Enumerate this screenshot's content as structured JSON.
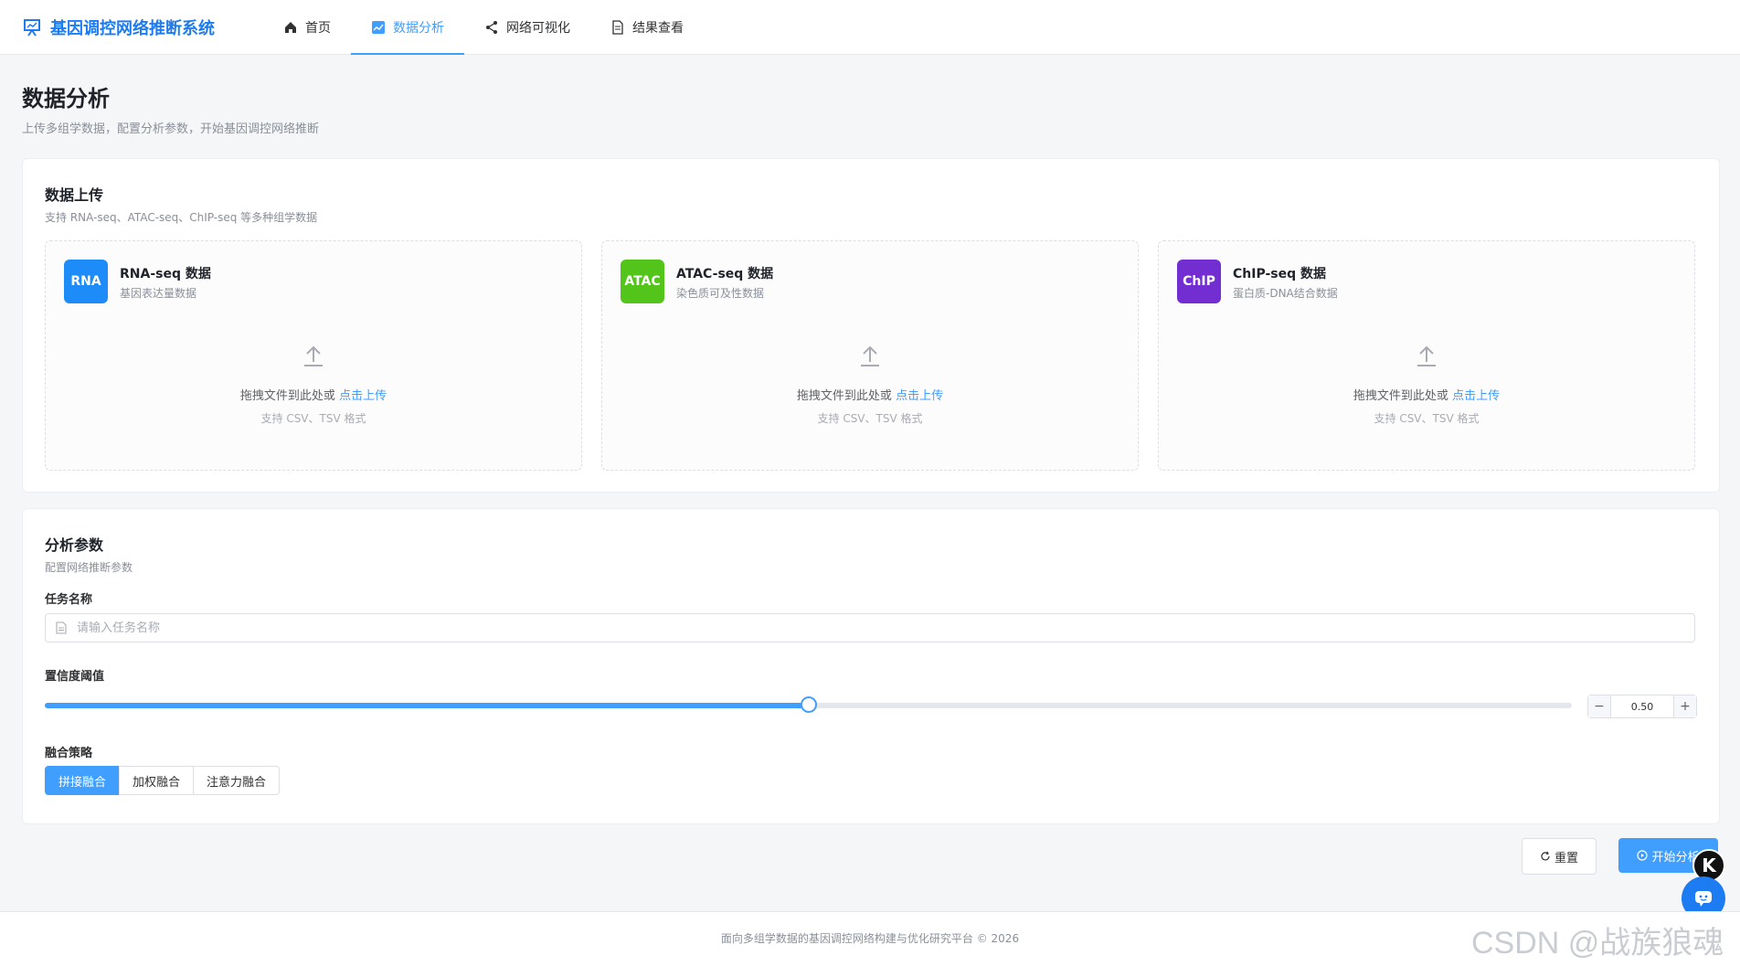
{
  "app": {
    "title": "基因调控网络推断系统"
  },
  "nav": {
    "items": [
      {
        "label": "首页",
        "icon": "home-icon"
      },
      {
        "label": "数据分析",
        "icon": "chart-icon",
        "active": true
      },
      {
        "label": "网络可视化",
        "icon": "share-icon"
      },
      {
        "label": "结果查看",
        "icon": "document-icon"
      }
    ]
  },
  "page": {
    "title": "数据分析",
    "subtitle": "上传多组学数据，配置分析参数，开始基因调控网络推断"
  },
  "upload": {
    "title": "数据上传",
    "desc": "支持 RNA-seq、ATAC-seq、ChIP-seq 等多种组学数据",
    "boxes": [
      {
        "badge": "RNA",
        "badge_color": "#1d8cf8",
        "title": "RNA-seq 数据",
        "sub": "基因表达量数据"
      },
      {
        "badge": "ATAC",
        "badge_color": "#52c41a",
        "title": "ATAC-seq 数据",
        "sub": "染色质可及性数据"
      },
      {
        "badge": "ChIP",
        "badge_color": "#722ed1",
        "title": "ChIP-seq 数据",
        "sub": "蛋白质-DNA结合数据"
      }
    ],
    "hint": "拖拽文件到此处或",
    "hint_link": "点击上传",
    "format": "支持 CSV、TSV 格式"
  },
  "params": {
    "title": "分析参数",
    "desc": "配置网络推断参数",
    "task_label": "任务名称",
    "task_placeholder": "请输入任务名称",
    "task_value": "",
    "conf_label": "置信度阈值",
    "conf_value": "0.50",
    "conf_fraction": 0.5,
    "fuse_label": "融合策略",
    "fuse_options": [
      "拼接融合",
      "加权融合",
      "注意力融合"
    ],
    "fuse_selected": 0
  },
  "actions": {
    "reset": "重置",
    "start": "开始分析"
  },
  "footer": {
    "text": "面向多组学数据的基因调控网络构建与优化研究平台 © 2026"
  },
  "watermark": "CSDN @战族狼魂",
  "colors": {
    "accent": "#409eff",
    "brand": "#1d7cf2"
  }
}
